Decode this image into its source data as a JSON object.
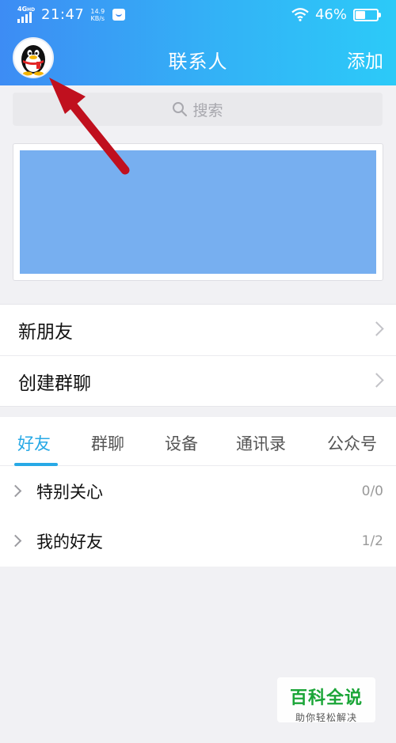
{
  "status_bar": {
    "network": "4G",
    "network_sup": "HD",
    "time": "21:47",
    "speed_value": "14.9",
    "speed_unit": "KB/s",
    "battery": "46%",
    "battery_level": 0.46
  },
  "header": {
    "title": "联系人",
    "add_label": "添加",
    "avatar_icon": "qq-penguin-avatar-icon"
  },
  "search": {
    "placeholder": "搜索",
    "icon": "search-icon"
  },
  "menu": {
    "items": [
      {
        "label": "新朋友"
      },
      {
        "label": "创建群聊"
      }
    ]
  },
  "tabs": [
    {
      "label": "好友"
    },
    {
      "label": "群聊"
    },
    {
      "label": "设备"
    },
    {
      "label": "通讯录"
    },
    {
      "label": "公众号"
    }
  ],
  "groups": [
    {
      "name": "特别关心",
      "count": "0/0"
    },
    {
      "name": "我的好友",
      "count": "1/2"
    }
  ],
  "watermark": {
    "title": "百科全说",
    "subtitle": "助你轻松解决"
  },
  "colors": {
    "header_start": "#3d8cf4",
    "header_end": "#2ccaf8",
    "accent": "#27a9e6",
    "banner": "#77aff0",
    "annotation_arrow": "#c0101e"
  }
}
